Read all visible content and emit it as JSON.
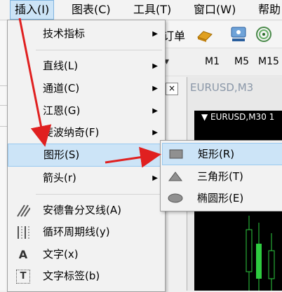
{
  "menubar": {
    "items": [
      "插入(I)",
      "图表(C)",
      "工具(T)",
      "窗口(W)",
      "帮助"
    ]
  },
  "toolbar": {
    "order_text": "订单",
    "icons": [
      "gold-bars-icon",
      "user-network-icon",
      "signal-icon"
    ]
  },
  "timeframes": [
    "M1",
    "M5",
    "M15"
  ],
  "chart": {
    "window_title": "EURUSD,M3",
    "label": "▼ EURUSD,M30  1"
  },
  "insert_menu": {
    "items": [
      {
        "label": "技术指标",
        "submenu": true
      },
      {
        "label": "直线(L)",
        "submenu": true
      },
      {
        "label": "通道(C)",
        "submenu": true
      },
      {
        "label": "江恩(G)",
        "submenu": true
      },
      {
        "label": "斐波纳奇(F)",
        "submenu": true
      },
      {
        "label": "图形(S)",
        "submenu": true,
        "highlighted": true
      },
      {
        "label": "箭头(r)",
        "submenu": true
      },
      {
        "label": "安德鲁分叉线(A)",
        "icon": "andrews-pitchfork-icon"
      },
      {
        "label": "循环周期线(y)",
        "icon": "cycle-lines-icon"
      },
      {
        "label": "文字(x)",
        "icon": "text-icon",
        "icon_glyph": "A"
      },
      {
        "label": "文字标签(b)",
        "icon": "text-label-icon",
        "icon_glyph": "T"
      }
    ]
  },
  "shapes_submenu": {
    "items": [
      {
        "label": "矩形(R)",
        "icon": "rectangle-icon",
        "highlighted": true
      },
      {
        "label": "三角形(T)",
        "icon": "triangle-icon"
      },
      {
        "label": "椭圆形(E)",
        "icon": "ellipse-icon"
      }
    ]
  },
  "colors": {
    "highlight": "#cce4f7",
    "arrow": "#e02020",
    "chart_bg": "#000000"
  }
}
